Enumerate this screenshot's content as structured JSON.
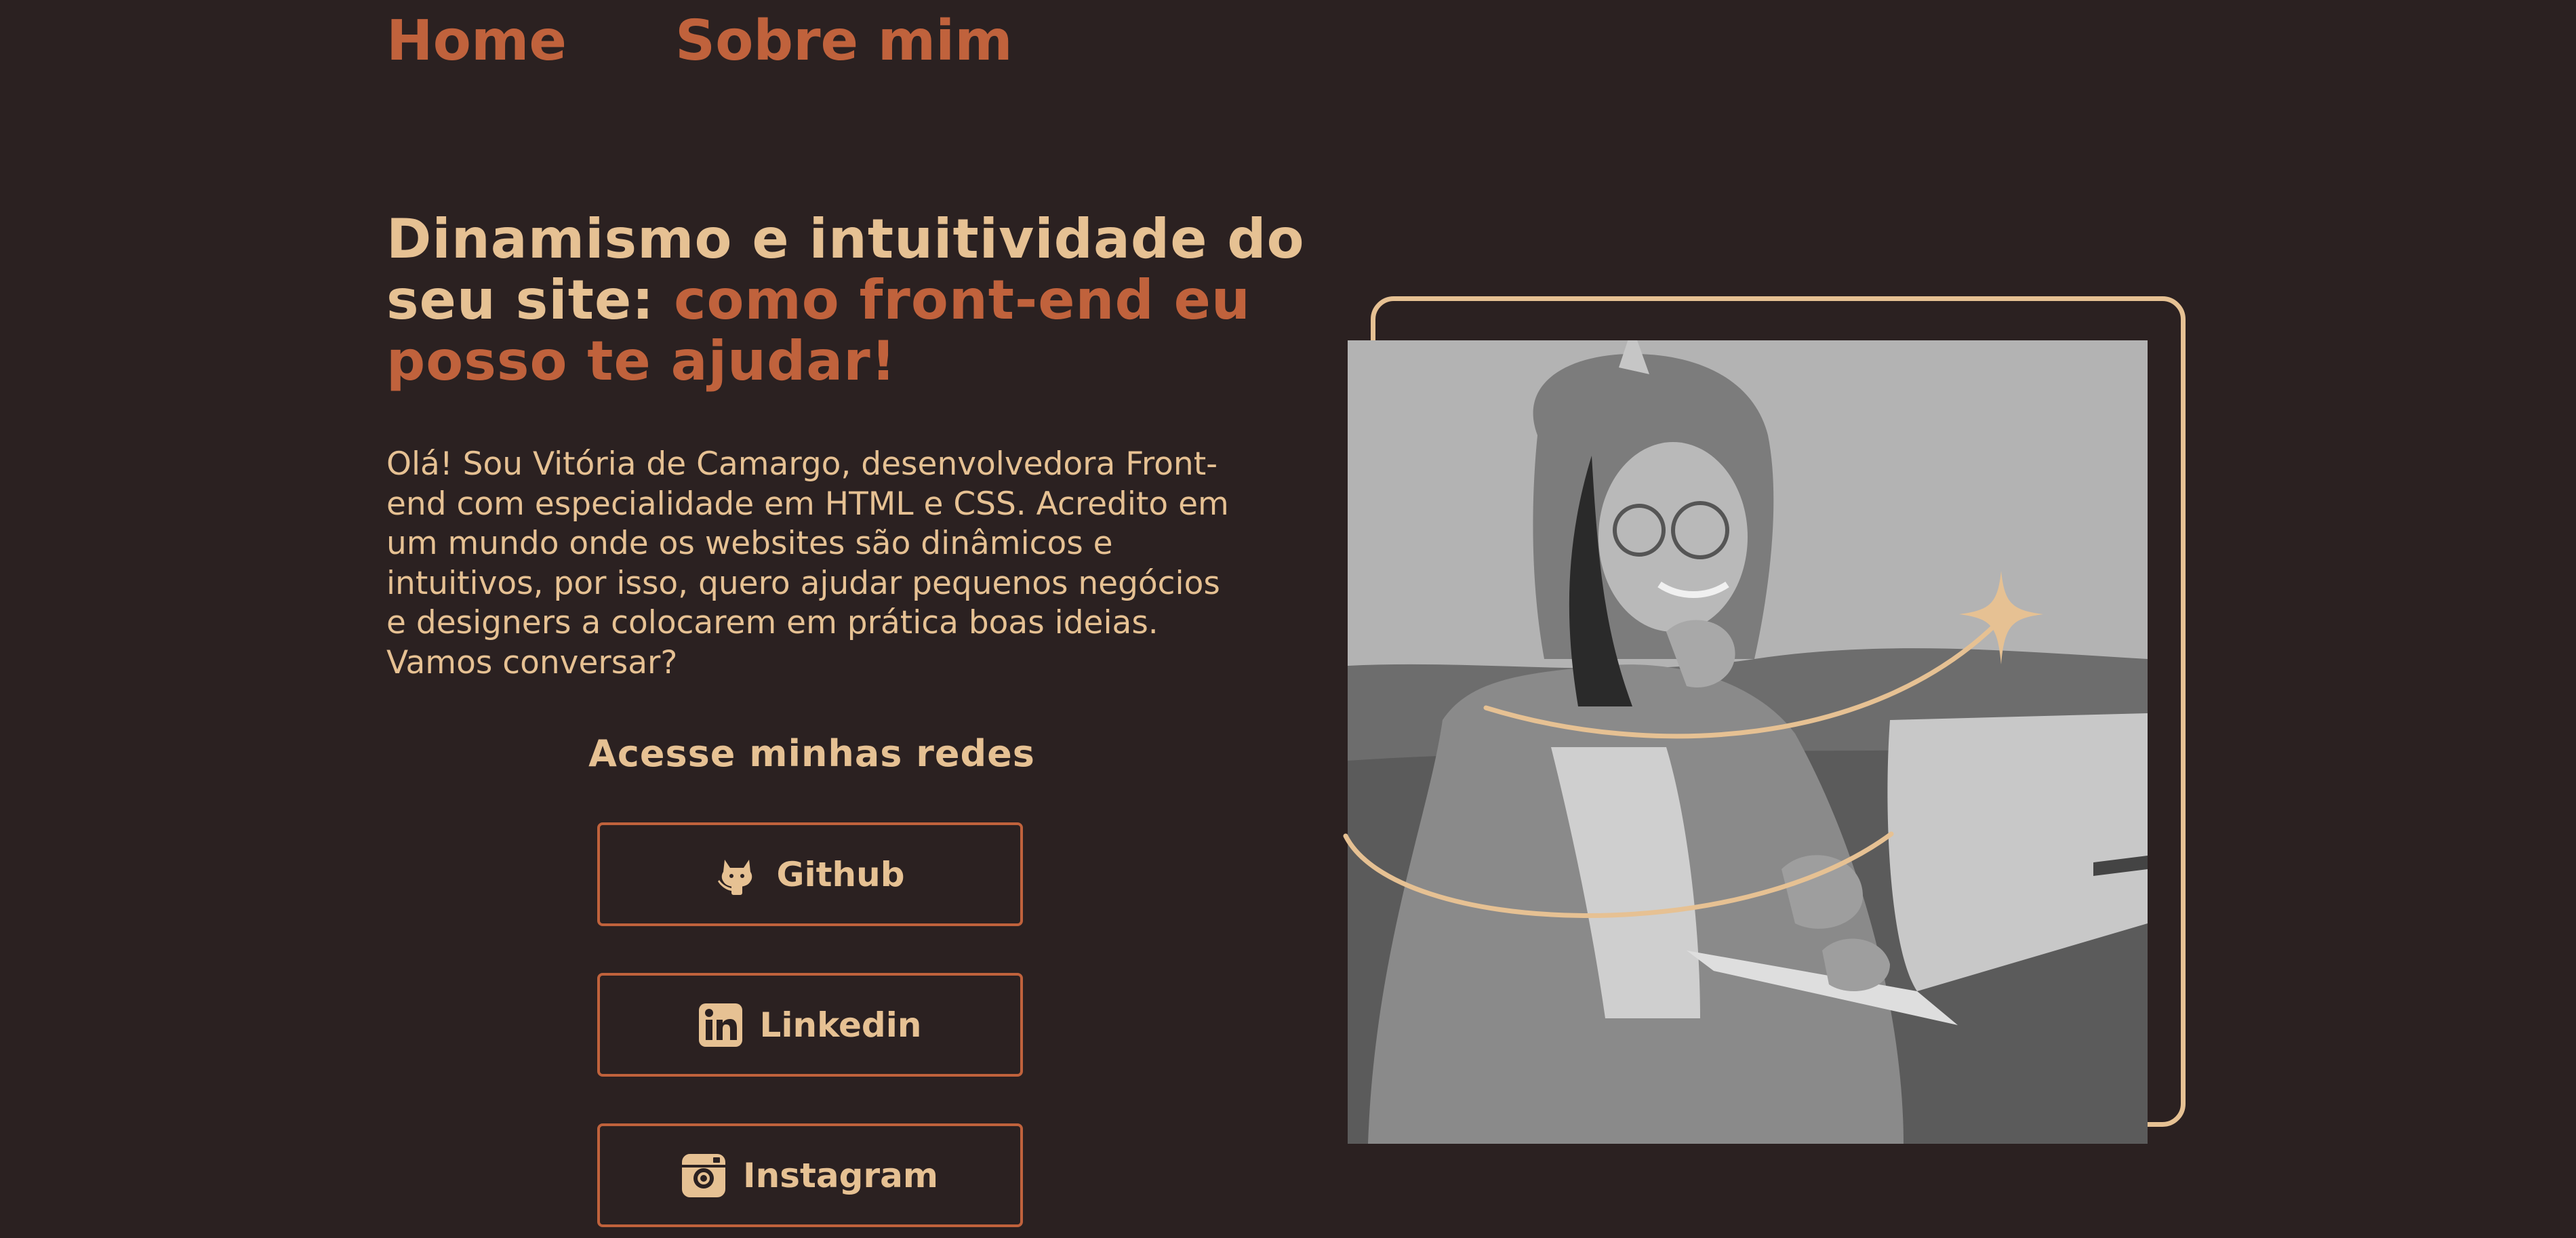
{
  "nav": {
    "items": [
      {
        "label": "Home"
      },
      {
        "label": "Sobre mim"
      }
    ]
  },
  "hero": {
    "headline_plain": "Dinamismo e intuitividade do seu site: ",
    "headline_accent": "como front-end eu posso te ajudar!",
    "intro": "Olá! Sou Vitória de Camargo, desenvolvedora Front-end com especialidade em HTML e CSS. Acredito em um mundo onde os websites são dinâmicos e intuitivos, por isso, quero ajudar pequenos negócios e designers a colocarem em prática boas ideias. Vamos conversar?"
  },
  "socials": {
    "title": "Acesse minhas redes",
    "links": [
      {
        "label": "Github",
        "icon": "github-icon"
      },
      {
        "label": "Linkedin",
        "icon": "linkedin-icon"
      },
      {
        "label": "Instagram",
        "icon": "instagram-icon"
      }
    ]
  },
  "image": {
    "subject": "portrait-photo",
    "frame_color": "#e6c193"
  },
  "colors": {
    "background": "#2b2121",
    "accent": "#c0623c",
    "text": "#e6c193"
  }
}
